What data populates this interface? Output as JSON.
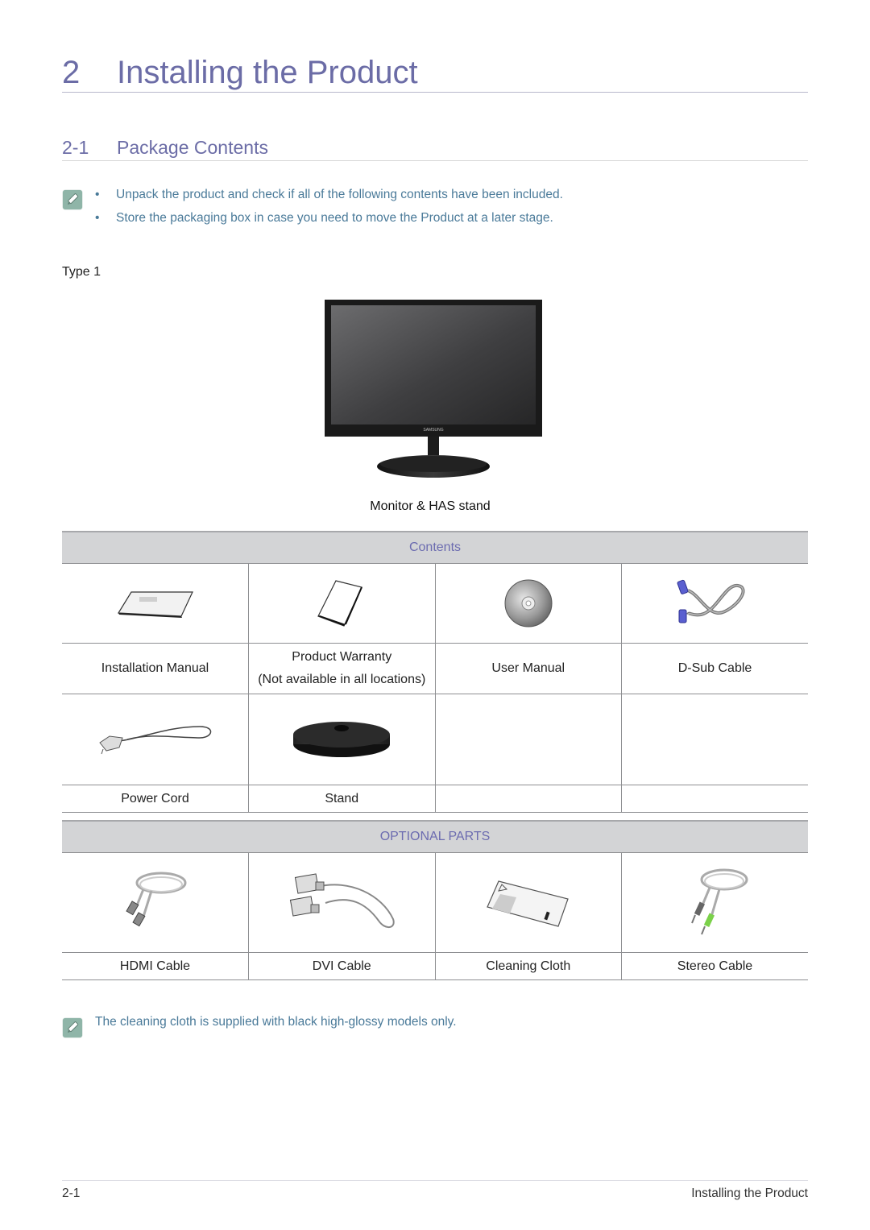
{
  "chapter": {
    "number": "2",
    "title": "Installing the Product"
  },
  "section": {
    "number": "2-1",
    "title": "Package Contents"
  },
  "notes": {
    "bullet_marker": "•",
    "items": [
      "Unpack the product and check if all of the following contents have been included.",
      "Store the packaging box in case you need to move the Product at a later stage."
    ],
    "icon": "note-pencil-icon"
  },
  "type_label": "Type 1",
  "monitor": {
    "caption": "Monitor & HAS stand",
    "brand": "SAMSUNG"
  },
  "contents_table": {
    "header": "Contents",
    "rows": [
      [
        {
          "label": "Installation Manual",
          "icon": "installation-manual-icon"
        },
        {
          "label": "Product Warranty",
          "sublabel": "(Not available in all locations)",
          "icon": "product-warranty-icon"
        },
        {
          "label": "User Manual",
          "icon": "cd-disc-icon"
        },
        {
          "label": "D-Sub Cable",
          "icon": "dsub-cable-icon"
        }
      ],
      [
        {
          "label": "Power Cord",
          "icon": "power-cord-icon"
        },
        {
          "label": "Stand",
          "icon": "stand-base-icon"
        },
        {
          "label": ""
        },
        {
          "label": ""
        }
      ]
    ]
  },
  "optional_table": {
    "header": "OPTIONAL PARTS",
    "rows": [
      [
        {
          "label": "HDMI Cable",
          "icon": "hdmi-cable-icon"
        },
        {
          "label": "DVI Cable",
          "icon": "dvi-cable-icon"
        },
        {
          "label": "Cleaning Cloth",
          "icon": "cleaning-cloth-icon"
        },
        {
          "label": "Stereo Cable",
          "icon": "stereo-cable-icon"
        }
      ]
    ]
  },
  "bottom_note": "The cleaning cloth is supplied with black high-glossy models only.",
  "footer": {
    "page": "2-1",
    "chapter_title": "Installing the Product"
  },
  "colors": {
    "heading": "#6b6ca6",
    "note_text": "#4a7a99",
    "table_header_bg": "#d3d4d6",
    "note_icon": "#8fb5a8"
  }
}
